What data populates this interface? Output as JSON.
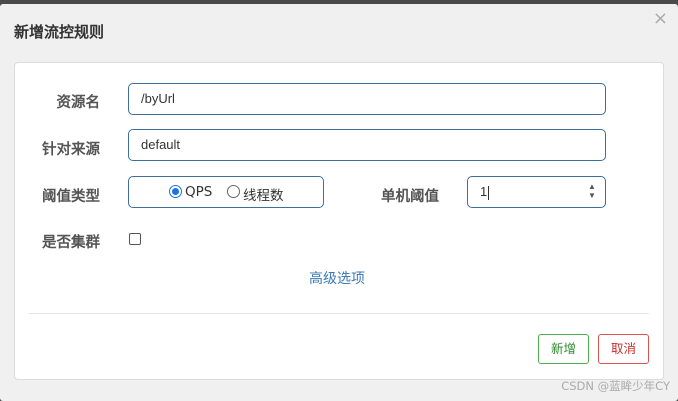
{
  "dialog": {
    "title": "新增流控规则",
    "close_glyph": "×"
  },
  "form": {
    "resource_label": "资源名",
    "resource_value": "/byUrl",
    "origin_label": "针对来源",
    "origin_value": "default",
    "threshold_type_label": "阈值类型",
    "threshold_type_options": [
      "QPS",
      "线程数"
    ],
    "threshold_type_selected": "QPS",
    "single_threshold_label": "单机阈值",
    "single_threshold_value": "1",
    "cluster_label": "是否集群",
    "cluster_checked": false,
    "advanced_link": "高级选项"
  },
  "buttons": {
    "add": "新增",
    "cancel": "取消"
  },
  "watermark": "CSDN @蓝眸少年CY",
  "colors": {
    "input_border": "#3c6e9e",
    "radio_accent": "#1a73e8",
    "add_button": "#4cae4c",
    "cancel_button": "#d9534f",
    "link": "#3a7ab8"
  }
}
